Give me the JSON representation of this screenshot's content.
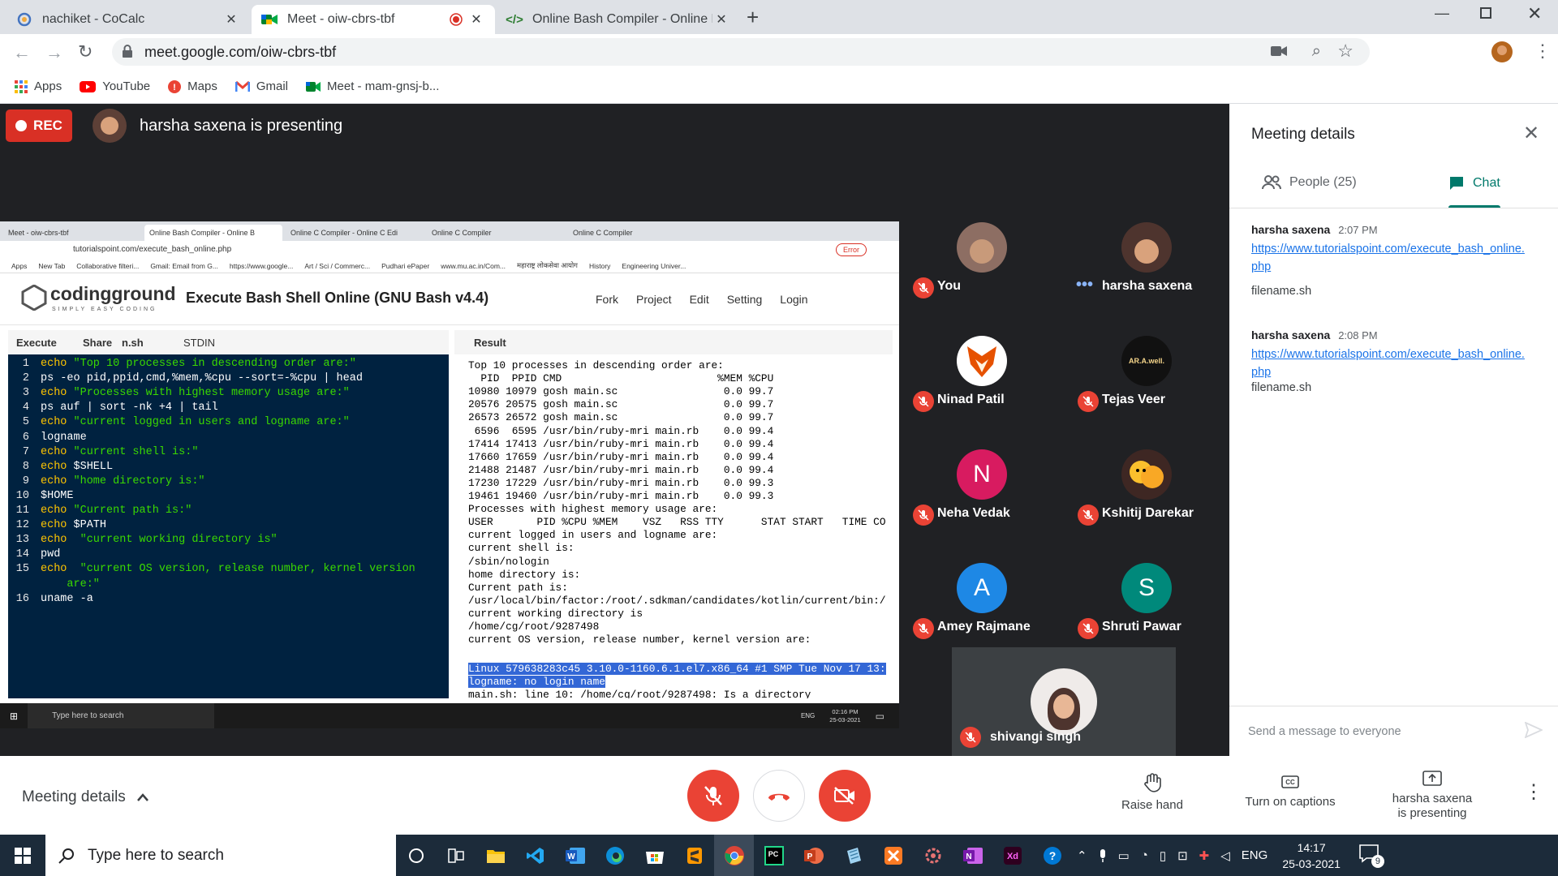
{
  "browser": {
    "tabs": [
      {
        "title": "nachiket - CoCalc"
      },
      {
        "title": "Meet - oiw-cbrs-tbf"
      },
      {
        "title": "Online Bash Compiler - Online Ba"
      }
    ],
    "url": "meet.google.com/oiw-cbrs-tbf",
    "bookmarks": [
      "Apps",
      "YouTube",
      "Maps",
      "Gmail",
      "Meet - mam-gnsj-b..."
    ]
  },
  "meet": {
    "rec_label": "REC",
    "presenting_banner": "harsha saxena is presenting",
    "participants": [
      {
        "name": "You"
      },
      {
        "name": "harsha saxena"
      },
      {
        "name": "Ninad Patil"
      },
      {
        "name": "Tejas Veer",
        "avatar_text": "AR.A.well."
      },
      {
        "name": "Neha Vedak",
        "initial": "N"
      },
      {
        "name": "Kshitij Darekar"
      },
      {
        "name": "Amey Rajmane",
        "initial": "A"
      },
      {
        "name": "Shruti Pawar",
        "initial": "S"
      },
      {
        "name": "shivangi singh"
      }
    ],
    "colors": {
      "neha": "#d81b60",
      "amey": "#1e88e5",
      "shruti": "#00897b"
    }
  },
  "panel": {
    "title": "Meeting details",
    "people_tab": "People (25)",
    "chat_tab": "Chat",
    "messages": [
      {
        "sender": "harsha saxena",
        "time": "2:07 PM",
        "link_line1": "https://www.tutorialspoint.com/execute_bash_online.",
        "link_line2": "php",
        "text": "filename.sh"
      },
      {
        "sender": "harsha saxena",
        "time": "2:08 PM",
        "link_line1": "https://www.tutorialspoint.com/execute_bash_online.",
        "link_line2": "php",
        "text": "filename.sh"
      }
    ],
    "input_placeholder": "Send a message to everyone"
  },
  "bottom": {
    "meeting_details": "Meeting details",
    "raise_hand": "Raise hand",
    "captions": "Turn on captions",
    "presenting_line1": "harsha saxena",
    "presenting_line2": "is presenting"
  },
  "taskbar": {
    "search": "Type here to search",
    "lang": "ENG",
    "time": "14:17",
    "date": "25-03-2021",
    "notif": "9"
  },
  "shared": {
    "tabs": [
      "Meet - oiw-cbrs-tbf",
      "Online Bash Compiler - Online B",
      "Online C Compiler - Online C Edi",
      "Online C Compiler",
      "Online C Compiler"
    ],
    "url": "tutorialspoint.com/execute_bash_online.php",
    "error_badge": "Error",
    "bookmarks": [
      "Apps",
      "New Tab",
      "Collaborative filteri...",
      "Gmail: Email from G...",
      "https://www.google...",
      "Art / Sci / Commerc...",
      "Pudhari ePaper",
      "www.mu.ac.in/Com...",
      "महाराष्ट्र लोकसेवा आयोग",
      "History",
      "Engineering Univer..."
    ],
    "logo": "codingground",
    "logo_sub": "SIMPLY EASY CODING",
    "heading": "Execute Bash Shell Online (GNU Bash v4.4)",
    "menu": [
      "Fork",
      "Project",
      "Edit",
      "Setting",
      "Login"
    ],
    "toolbar": {
      "execute": "Execute",
      "share": "Share",
      "file": "n.sh",
      "stdin": "STDIN",
      "result": "Result"
    },
    "code": [
      {
        "n": "1",
        "kw": "echo",
        "rest": " \"Top 10 processes in descending order are:\""
      },
      {
        "n": "2",
        "kw": "",
        "rest": "ps -eo pid,ppid,cmd,%mem,%cpu --sort=-%cpu | head"
      },
      {
        "n": "3",
        "kw": "echo",
        "rest": " \"Processes with highest memory usage are:\""
      },
      {
        "n": "4",
        "kw": "",
        "rest": "ps auf | sort -nk +4 | tail"
      },
      {
        "n": "5",
        "kw": "echo",
        "rest": " \"current logged in users and logname are:\""
      },
      {
        "n": "6",
        "kw": "",
        "rest": "logname"
      },
      {
        "n": "7",
        "kw": "echo",
        "rest": " \"current shell is:\""
      },
      {
        "n": "8",
        "kw": "echo",
        "rest": " $SHELL"
      },
      {
        "n": "9",
        "kw": "echo",
        "rest": " \"home directory is:\""
      },
      {
        "n": "10",
        "kw": "",
        "rest": "$HOME"
      },
      {
        "n": "11",
        "kw": "echo",
        "rest": " \"Current path is:\""
      },
      {
        "n": "12",
        "kw": "echo",
        "rest": " $PATH"
      },
      {
        "n": "13",
        "kw": "echo",
        "rest": "  \"current working directory is\""
      },
      {
        "n": "14",
        "kw": "",
        "rest": "pwd"
      },
      {
        "n": "15",
        "kw": "echo",
        "rest": "  \"current OS version, release number, kernel version"
      },
      {
        "n": "",
        "kw": "",
        "rest": "    are:\""
      },
      {
        "n": "16",
        "kw": "",
        "rest": "uname -a"
      }
    ],
    "output": [
      "Top 10 processes in descending order are:",
      "  PID  PPID CMD                         %MEM %CPU",
      "10980 10979 gosh main.sc                 0.0 99.7",
      "20576 20575 gosh main.sc                 0.0 99.7",
      "26573 26572 gosh main.sc                 0.0 99.7",
      " 6596  6595 /usr/bin/ruby-mri main.rb    0.0 99.4",
      "17414 17413 /usr/bin/ruby-mri main.rb    0.0 99.4",
      "17660 17659 /usr/bin/ruby-mri main.rb    0.0 99.4",
      "21488 21487 /usr/bin/ruby-mri main.rb    0.0 99.4",
      "17230 17229 /usr/bin/ruby-mri main.rb    0.0 99.3",
      "19461 19460 /usr/bin/ruby-mri main.rb    0.0 99.3",
      "Processes with highest memory usage are:",
      "USER       PID %CPU %MEM    VSZ   RSS TTY      STAT START   TIME CO",
      "current logged in users and logname are:",
      "current shell is:",
      "/sbin/nologin",
      "home directory is:",
      "Current path is:",
      "/usr/local/bin/factor:/root/.sdkman/candidates/kotlin/current/bin:/",
      "current working directory is",
      "/home/cg/root/9287498",
      "current OS version, release number, kernel version are:"
    ],
    "highlight1": "Linux 579638283c45 3.10.0-1160.6.1.el7.x86_64 #1 SMP Tue Nov 17 13:",
    "highlight2": "logname: no login name",
    "last_line": "main.sh: line 10: /home/cg/root/9287498: Is a directory",
    "taskbar_search": "Type here to search",
    "taskbar_lang": "ENG",
    "taskbar_time": "02:16 PM",
    "taskbar_date": "25-03-2021"
  }
}
